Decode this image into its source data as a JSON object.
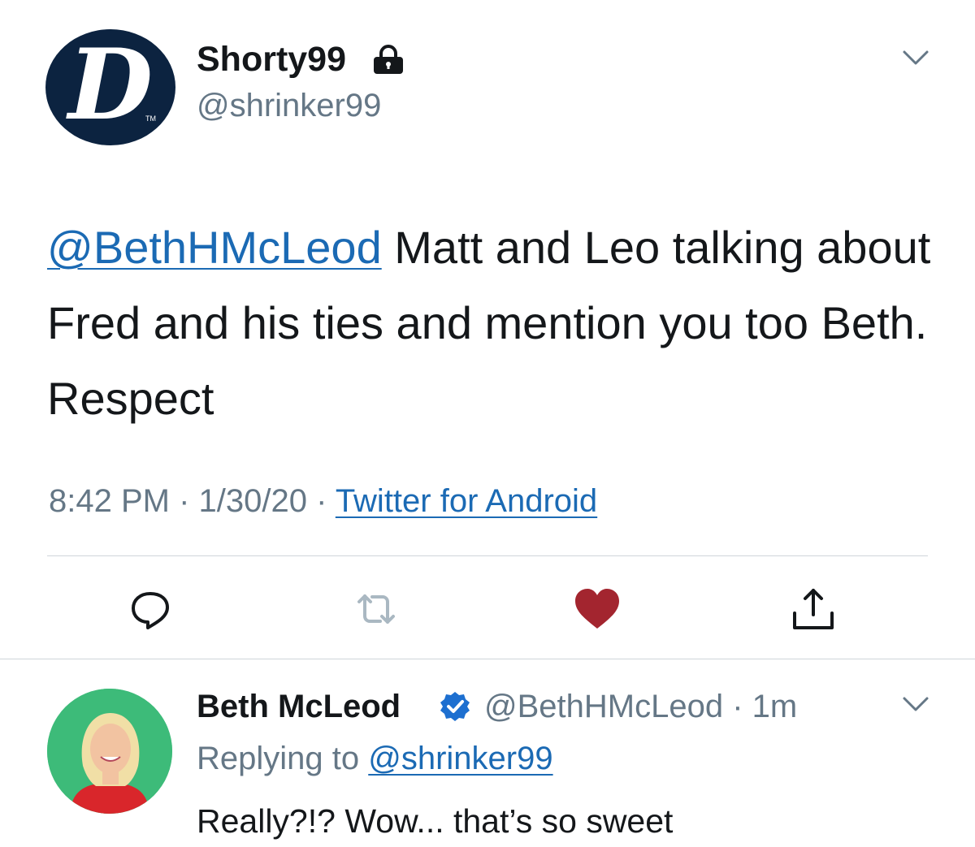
{
  "tweet": {
    "display_name": "Shorty99",
    "handle": "@shrinker99",
    "avatar_icon": "detroit-d-logo",
    "avatar_letter": "D",
    "avatar_tm": "TM",
    "protected_icon": "lock-icon",
    "mention": "@BethHMcLeod",
    "body": " Matt and Leo talking about Fred and his ties and mention you too Beth.  Respect",
    "time": "8:42 PM",
    "date": "1/30/20",
    "separator": " · ",
    "source": "Twitter for Android",
    "liked": true,
    "actions": [
      "reply-icon",
      "retweet-icon",
      "like-icon",
      "share-icon"
    ]
  },
  "reply": {
    "display_name": "Beth McLeod",
    "verified_icon": "verified-icon",
    "handle": "@BethHMcLeod",
    "time_sep": " · ",
    "time": "1m",
    "replying_to_label": "Replying to ",
    "replying_to_handle": "@shrinker99",
    "body": "Really?!? Wow... that’s so sweet"
  },
  "colors": {
    "link": "#1b6ab4",
    "muted": "#657786",
    "like": "#a3252f",
    "avatar_bg": "#0c2340",
    "reply_avatar_bg": "#3dbb79"
  }
}
